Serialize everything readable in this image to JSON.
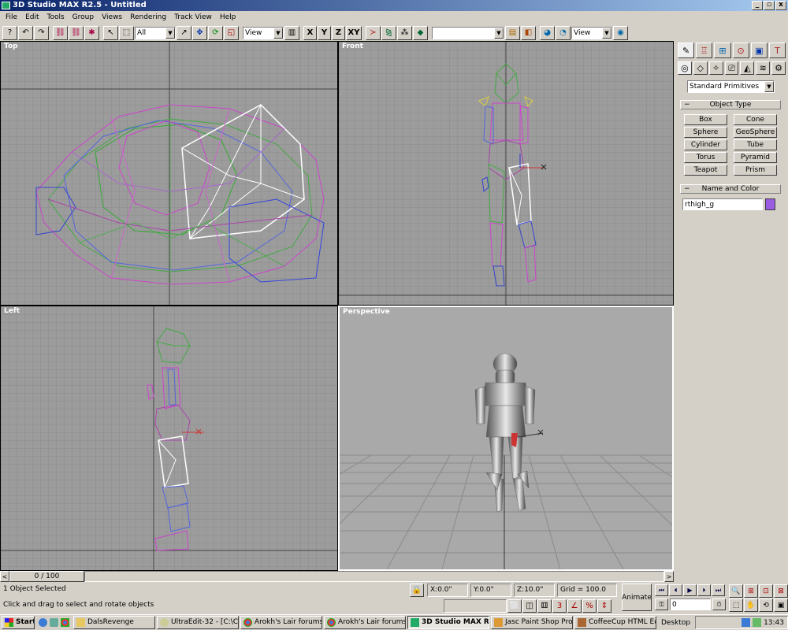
{
  "window": {
    "title": "3D Studio MAX R2.5 - Untitled",
    "buttons": [
      "_",
      "▫",
      "x"
    ]
  },
  "menu": [
    "File",
    "Edit",
    "Tools",
    "Group",
    "Views",
    "Rendering",
    "Track View",
    "Help"
  ],
  "toolbar": {
    "selection_filter": "All",
    "ref_coord": "View",
    "axis_x": "X",
    "axis_y": "Y",
    "axis_z": "Z",
    "axis_xy": "XY",
    "named_selection": "",
    "render_type": "View"
  },
  "viewports": [
    {
      "name": "Top"
    },
    {
      "name": "Front"
    },
    {
      "name": "Left"
    },
    {
      "name": "Perspective"
    }
  ],
  "command_panel": {
    "category": "Standard Primitives",
    "object_type_header": "Object Type",
    "buttons": [
      "Box",
      "Cone",
      "Sphere",
      "GeoSphere",
      "Cylinder",
      "Tube",
      "Torus",
      "Pyramid",
      "Teapot",
      "Prism"
    ],
    "name_color_header": "Name and Color",
    "object_name": "rthigh_g",
    "object_color": "#9a5ce0",
    "rollout_toggle": "−"
  },
  "timeline": {
    "frame": "0 / 100",
    "left_arrow": "<",
    "right_arrow": ">"
  },
  "status": {
    "selection": "1 Object Selected",
    "prompt": "Click and drag to select and rotate objects",
    "x": "X:0.0\"",
    "y": "Y:0.0\"",
    "z": "Z:10.0\"",
    "grid": "Grid = 100.0",
    "animate": "Animate",
    "frame_field": "0"
  },
  "taskbar": {
    "start": "Start",
    "tasks": [
      "DalsRevenge",
      "UltraEdit-32 - [C:\\C...",
      "Arokh's Lair forums ...",
      "Arokh's Lair forums ...",
      "3D Studio MAX R...",
      "Jasc Paint Shop Pro...",
      "CoffeeCup HTML Ed..."
    ],
    "desktop": "Desktop",
    "clock": "13:43"
  },
  "colors": {
    "titlebar": "#0a246a",
    "viewport_bg": "#9c9c9c",
    "grid": "#8a8a8a",
    "selected": "#ffffff"
  }
}
